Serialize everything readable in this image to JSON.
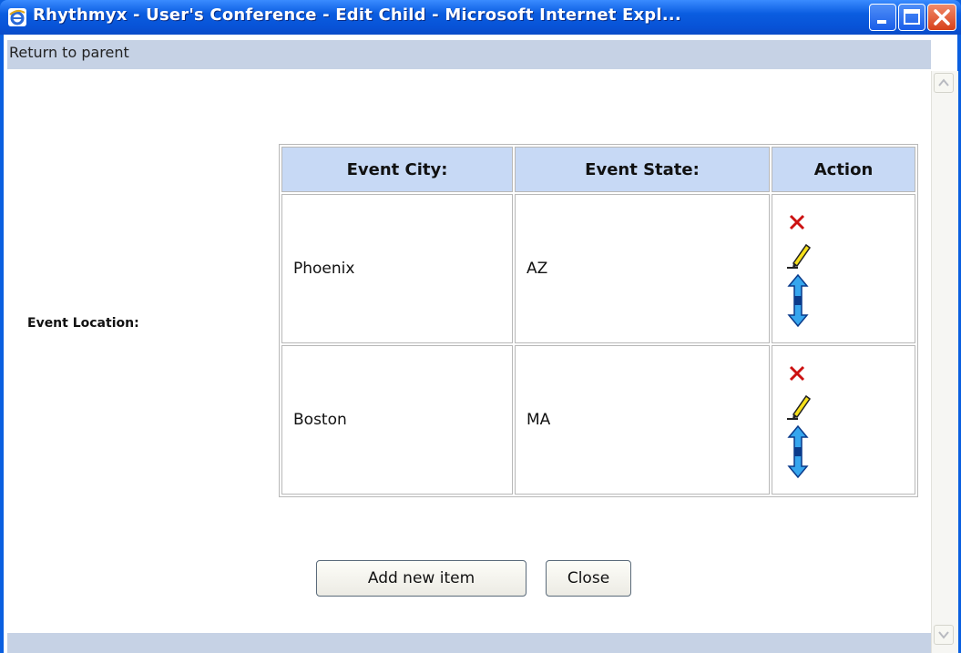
{
  "window": {
    "title": "Rhythmyx - User's Conference - Edit Child - Microsoft Internet Expl..."
  },
  "nav": {
    "return_link": "Return to parent"
  },
  "form": {
    "field_label": "Event Location:"
  },
  "table": {
    "headers": [
      "Event City:",
      "Event State:",
      "Action"
    ],
    "rows": [
      {
        "city": "Phoenix",
        "state": "AZ"
      },
      {
        "city": "Boston",
        "state": "MA"
      }
    ],
    "action_icons": [
      "delete-icon",
      "edit-pencil-icon",
      "move-arrow-icon"
    ]
  },
  "buttons": {
    "add_label": "Add new item",
    "close_label": "Close"
  },
  "colors": {
    "titlebar": "#0a5de0",
    "header_bg": "#c7d9f5",
    "bar_bg": "#c6d2e5",
    "delete": "#cc1111"
  }
}
